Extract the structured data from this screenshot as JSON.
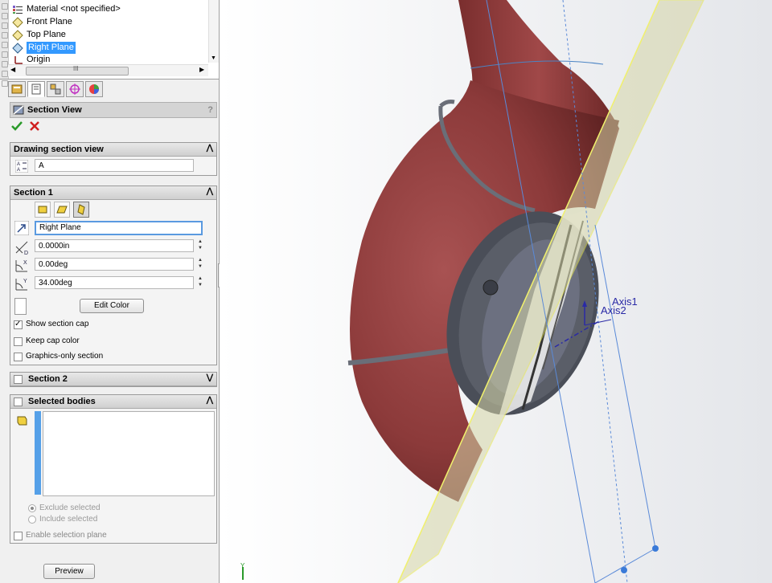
{
  "tree": {
    "items": [
      {
        "label": "Material <not specified>",
        "icon": "material-icon"
      },
      {
        "label": "Front Plane",
        "icon": "plane-icon"
      },
      {
        "label": "Top Plane",
        "icon": "plane-icon"
      },
      {
        "label": "Right Plane",
        "icon": "plane-icon",
        "selected": true
      },
      {
        "label": "Origin",
        "icon": "origin-icon"
      }
    ],
    "scroll_grip": "III"
  },
  "pm": {
    "title": "Section View",
    "help": "?",
    "drawing_section": {
      "header": "Drawing section view",
      "name_value": "A"
    },
    "section1": {
      "header": "Section 1",
      "reference": "Right Plane",
      "offset": "0.0000in",
      "angle_x": "0.00deg",
      "angle_y": "34.00deg",
      "edit_color_label": "Edit Color",
      "show_cap_label": "Show section cap",
      "show_cap_checked": true,
      "keep_cap_label": "Keep cap color",
      "graphics_only_label": "Graphics-only section"
    },
    "section2": {
      "header": "Section 2"
    },
    "selected_bodies": {
      "header": "Selected bodies",
      "exclude_label": "Exclude selected",
      "include_label": "Include selected",
      "enable_plane_label": "Enable selection plane"
    },
    "preview_label": "Preview"
  },
  "viewport": {
    "axis1_label": "Axis1",
    "axis2_label": "Axis2",
    "triad_y_label": "Y",
    "colors": {
      "part": "#8c3a3a",
      "plane": "#d6d6a8",
      "axis": "#2a2aa6"
    }
  }
}
